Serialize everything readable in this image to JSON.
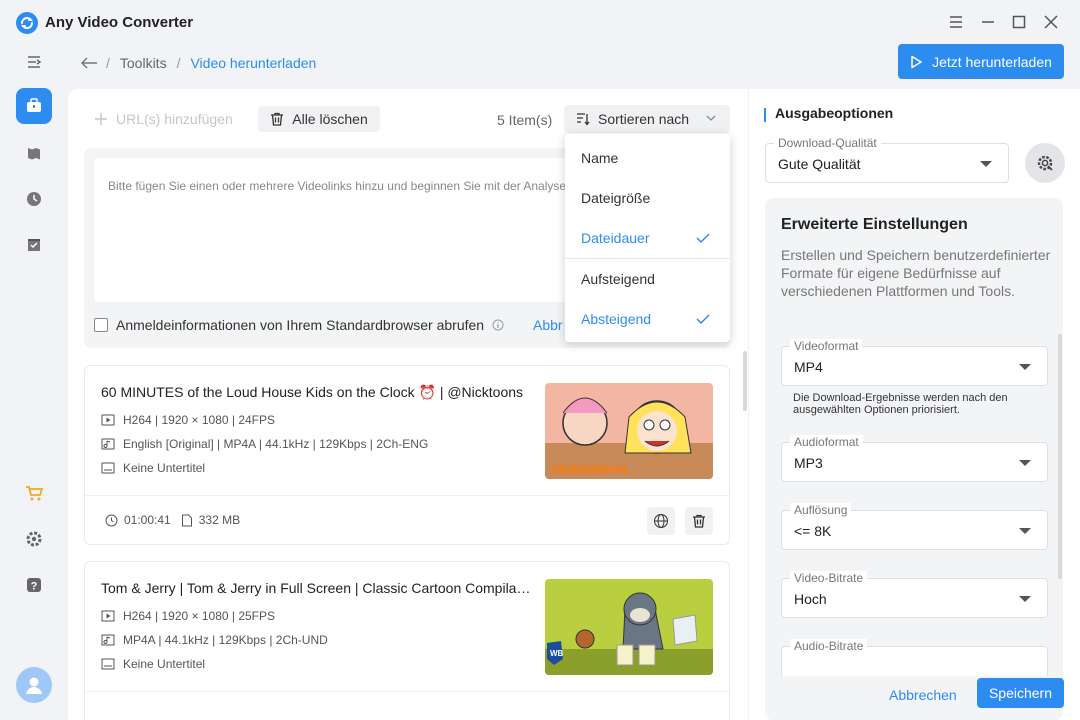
{
  "app": {
    "title": "Any Video Converter"
  },
  "breadcrumb": {
    "root": "Toolkits",
    "current": "Video herunterladen"
  },
  "header": {
    "download_label": "Jetzt herunterladen"
  },
  "toolbar": {
    "add_url": "URL(s) hinzufügen",
    "clear_all": "Alle löschen",
    "count": "5 Item(s)",
    "sort_label": "Sortieren nach"
  },
  "paste": {
    "placeholder": "Bitte fügen Sie einen oder mehrere Videolinks hinzu und beginnen Sie mit der Analyse.",
    "cred_label": "Anmeldeinformationen von Ihrem Standardbrowser abrufen",
    "cred_link": "Abbr"
  },
  "sort_menu": {
    "items": [
      {
        "label": "Name",
        "selected": false
      },
      {
        "label": "Dateigröße",
        "selected": false
      },
      {
        "label": "Dateidauer",
        "selected": true
      },
      {
        "label": "Aufsteigend",
        "selected": false
      },
      {
        "label": "Absteigend",
        "selected": true
      }
    ]
  },
  "videos": [
    {
      "title": "60 MINUTES of the Loud House Kids on the Clock ⏰ | @Nicktoons",
      "video": "H264 | 1920 × 1080 | 24FPS",
      "audio": "English [Original] | MP4A | 44.1kHz | 129Kbps | 2Ch-ENG",
      "subtitle": "Keine Untertitel",
      "duration": "01:00:41",
      "size": "332 MB",
      "thumb_label": "nickelodeon"
    },
    {
      "title": "Tom & Jerry | Tom & Jerry in Full Screen | Classic Cartoon Compilation | WB Kids",
      "video": "H264 | 1920 × 1080 | 25FPS",
      "audio": "MP4A | 44.1kHz | 129Kbps | 2Ch-UND",
      "subtitle": "Keine Untertitel",
      "duration": "",
      "size": "",
      "thumb_label": "WB"
    }
  ],
  "output": {
    "title": "Ausgabeoptionen",
    "quality_label": "Download-Qualität",
    "quality_value": "Gute Qualität",
    "adv_title": "Erweiterte Einstellungen",
    "adv_desc": "Erstellen und Speichern benutzerdefinierter Formate für eigene Bedürfnisse auf verschiedenen Plattformen und Tools.",
    "video_format_label": "Videoformat",
    "video_format_value": "MP4",
    "note": "Die Download-Ergebnisse werden nach den ausgewählten Optionen priorisiert.",
    "audio_format_label": "Audioformat",
    "audio_format_value": "MP3",
    "resolution_label": "Auflösung",
    "resolution_value": "<= 8K",
    "video_bitrate_label": "Video-Bitrate",
    "video_bitrate_value": "Hoch",
    "audio_bitrate_label": "Audio-Bitrate",
    "cancel": "Abbrechen",
    "save": "Speichern"
  },
  "colors": {
    "accent": "#2d8cf0",
    "background": "#f1f3f6"
  }
}
